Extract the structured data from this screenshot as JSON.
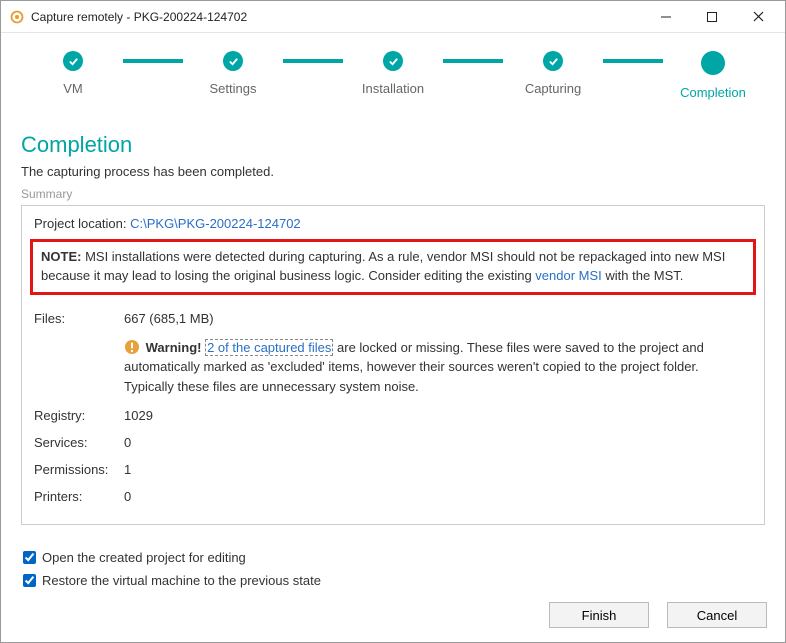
{
  "window": {
    "title": "Capture remotely - PKG-200224-124702"
  },
  "stepper": {
    "steps": [
      {
        "label": "VM"
      },
      {
        "label": "Settings"
      },
      {
        "label": "Installation"
      },
      {
        "label": "Capturing"
      },
      {
        "label": "Completion"
      }
    ]
  },
  "page": {
    "title": "Completion",
    "subtitle": "The capturing process has been completed.",
    "summary_label": "Summary"
  },
  "summary": {
    "project_location_label": "Project location: ",
    "project_location_path": "C:\\PKG\\PKG-200224-124702",
    "note_prefix": "NOTE:",
    "note_text_before": " MSI installations were detected during capturing. As a rule, vendor MSI should not be repackaged into new MSI because it may lead to losing the original business logic. Consider editing the existing ",
    "note_link": "vendor MSI",
    "note_text_after": " with the MST.",
    "rows": {
      "files": {
        "label": "Files:",
        "value": "667 (685,1 MB)"
      },
      "registry": {
        "label": "Registry:",
        "value": "1029"
      },
      "services": {
        "label": "Services:",
        "value": "0"
      },
      "permissions": {
        "label": "Permissions:",
        "value": "1"
      },
      "printers": {
        "label": "Printers:",
        "value": "0"
      }
    },
    "warning": {
      "label": "Warning!",
      "link": "2 of the captured files",
      "text": " are locked or missing. These files were saved to the project and automatically marked as 'excluded' items, however their sources weren't copied to the project folder. Typically these files are unnecessary system noise."
    }
  },
  "footer": {
    "checkbox_open": "Open the created project for editing",
    "checkbox_restore": "Restore the virtual machine to the previous state",
    "finish": "Finish",
    "cancel": "Cancel"
  }
}
